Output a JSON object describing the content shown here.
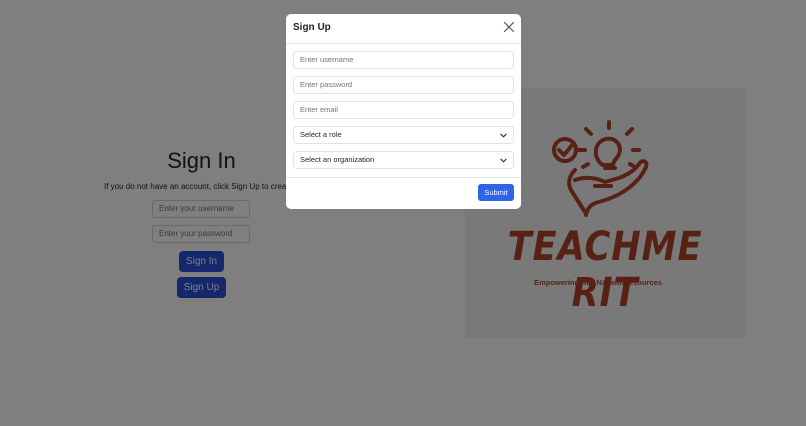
{
  "signin": {
    "title": "Sign In",
    "hint": "If you do not have an account, click Sign Up to create a",
    "username_placeholder": "Enter your username",
    "password_placeholder": "Enter your password",
    "signin_label": "Sign In",
    "signup_label": "Sign Up"
  },
  "logo": {
    "name": "TEACHME RIT",
    "tagline": "Empowering ALANA with resources",
    "color": "#b0432a"
  },
  "modal": {
    "title": "Sign Up",
    "close_icon": "close-icon",
    "fields": {
      "username_placeholder": "Enter username",
      "password_placeholder": "Enter password",
      "email_placeholder": "Enter email",
      "role_selected": "Select a role",
      "organization_selected": "Select an organization"
    },
    "submit_label": "Submit"
  },
  "colors": {
    "primary": "#2f64e6",
    "backdrop": "rgba(0,0,0,0.5)"
  }
}
